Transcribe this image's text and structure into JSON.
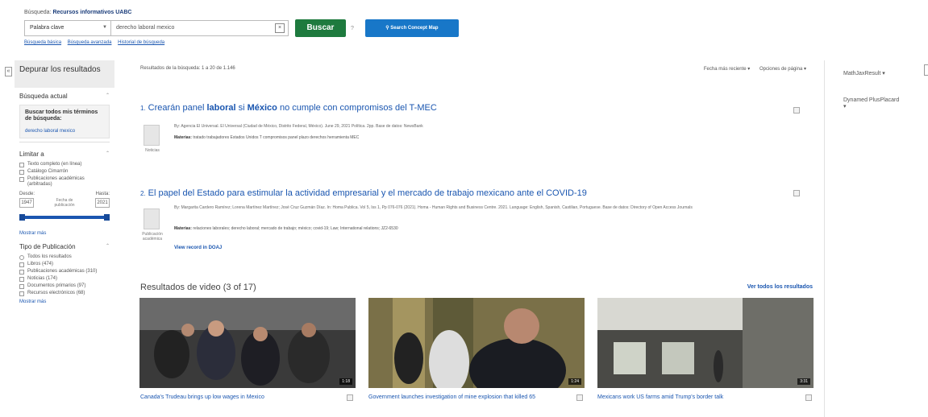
{
  "header": {
    "crumb_label": "Búsqueda:",
    "crumb_value": "Recursos informativos UABC",
    "field_select": "Palabra clave",
    "query": "derecho laboral mexico",
    "search_button": "Buscar",
    "help": "?",
    "concept_map": "Search Concept Map",
    "links": [
      "Búsqueda básica",
      "Búsqueda avanzada",
      "Historial de búsqueda"
    ]
  },
  "sidebar": {
    "title": "Depurar los resultados",
    "current_search": "Búsqueda actual",
    "find_all_label": "Buscar todos mis términos de búsqueda:",
    "find_all_query": "derecho laboral mexico",
    "limit_to": "Limitar a",
    "limits": [
      "Texto completo (en línea)",
      "Catálogo Cimarrón",
      "Publicaciones académicas (arbitradas)"
    ],
    "date_from_label": "Desde:",
    "date_to_label": "Hasta:",
    "date_from": "1947",
    "date_to": "2021",
    "date_mid_label": "Fecha de publicación",
    "show_more_1": "Mostrar más",
    "pub_type": "Tipo de Publicación",
    "pub_types": [
      "Todos los resultados",
      "Libros (474)",
      "Publicaciones académicas (310)",
      "Noticias (174)",
      "Documentos primarios (97)",
      "Recursos electrónicos (68)"
    ],
    "show_more_2": "Mostrar más"
  },
  "main": {
    "count": "Resultados de la búsqueda: 1 a 20 de 1.146",
    "sort": "Fecha más reciente ▾",
    "options": "Opciones de página ▾",
    "results": [
      {
        "num": "1.",
        "title_a": "Crearán panel ",
        "title_b": "laboral",
        "title_c": " si ",
        "title_d": "México",
        "title_e": " no cumple con compromisos del T-MEC",
        "meta": "By: Agencia El Universal. El Universal (Ciudad de México, Distrito Federal, México). June 29, 2021 Política. 2pp. Base de datos: NewsBank",
        "subj_label": "Materias:",
        "subj": "tratado trabajadores Estados Unidos T compromisos panel plazo derechos herramienta MEC",
        "type": "Noticias"
      },
      {
        "num": "2.",
        "title": "El papel del Estado para estimular la actividad empresarial y el mercado de trabajo mexicano ante el COVID-19",
        "meta": "By: Margarita Cardero Ramírez; Lorena Martínez Martínez; José Cruz Guzmán Díaz. In: Homa Publica. Vol 5, Iss 1, Pp 076-076 (2021). Homa - Human Rights and Business Centre. 2021. Language: English, Spanish, Castilian, Portuguese. Base de datos: Directory of Open Access Journals",
        "subj_label": "Materias:",
        "subj": "relaciones laborales; derecho laboral; mercado de trabajo; méxico; covid-19; Law; International relations; JZ2-6530",
        "link": "View record in DOAJ",
        "type": "Publicación académica"
      }
    ],
    "video_heading": "Resultados de video (3 of 17)",
    "video_all": "Ver todos los resultados",
    "videos": [
      {
        "caption": "Canada's Trudeau brings up low wages in Mexico",
        "duration": "1:18"
      },
      {
        "caption": "Government launches investigation of mine explosion that killed 65",
        "duration": "1:24"
      },
      {
        "caption": "Mexicans work US farms amid Trump's border talk",
        "duration": "3:31"
      }
    ]
  },
  "right": {
    "item1": "MathJaxResult ▾",
    "item2": "Dynamed PlusPlacard ▾"
  }
}
